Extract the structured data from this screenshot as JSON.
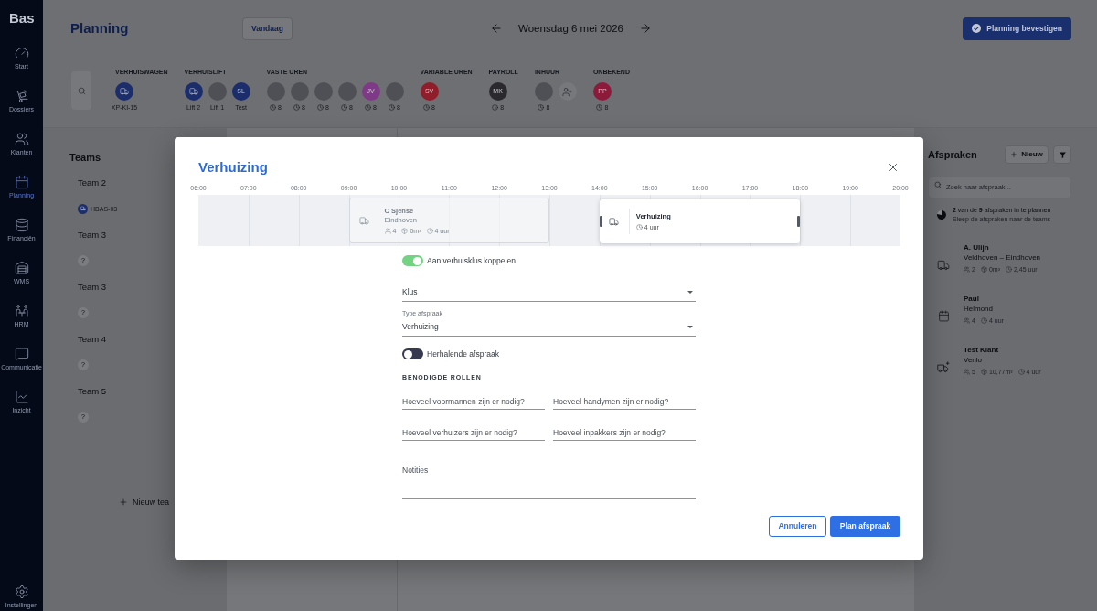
{
  "sidebar": {
    "logo": "Bas",
    "items": [
      {
        "label": "Start",
        "selected": false
      },
      {
        "label": "Dossiers",
        "selected": false
      },
      {
        "label": "Klanten",
        "selected": false
      },
      {
        "label": "Planning",
        "selected": true
      },
      {
        "label": "Financiën",
        "selected": false
      },
      {
        "label": "WMS",
        "selected": false
      },
      {
        "label": "HRM",
        "selected": false
      },
      {
        "label": "Communicatie",
        "selected": false
      },
      {
        "label": "Inzicht",
        "selected": false
      }
    ],
    "settings": "Instellingen"
  },
  "header": {
    "title": "Planning",
    "today": "Vandaag",
    "date": "Woensdag 6 mei 2026",
    "confirm": "Planning bevestigen"
  },
  "resources": [
    {
      "title": "VERHUISWAGEN",
      "add_button": false,
      "items": [
        {
          "kind": "icon",
          "label": "XP-KI-15"
        }
      ]
    },
    {
      "title": "VERHUISLIFT",
      "add_button": false,
      "items": [
        {
          "kind": "icon",
          "label": "Lift 2"
        },
        {
          "kind": "photo",
          "label": "Lift 1"
        },
        {
          "kind": "initials",
          "initials": "SL",
          "color": "#1b2d6b",
          "label": "Test"
        }
      ]
    },
    {
      "title": "VASTE UREN",
      "add_button": false,
      "items": [
        {
          "kind": "photo",
          "hours": "8"
        },
        {
          "kind": "photo",
          "hours": "8"
        },
        {
          "kind": "photo",
          "hours": "8"
        },
        {
          "kind": "photo",
          "hours": "8"
        },
        {
          "kind": "initials",
          "initials": "JV",
          "color": "#7e3a86",
          "hours": "8"
        },
        {
          "kind": "photo",
          "hours": "8"
        }
      ]
    },
    {
      "title": "VARIABLE UREN",
      "add_button": false,
      "items": [
        {
          "kind": "initials",
          "initials": "SV",
          "color": "#8f1d2a",
          "hours": "8"
        }
      ]
    },
    {
      "title": "PAYROLL",
      "add_button": false,
      "items": [
        {
          "kind": "initials",
          "initials": "MK",
          "color": "#2a2a2e",
          "hours": "8"
        }
      ]
    },
    {
      "title": "INHUUR",
      "add_button": true,
      "items": [
        {
          "kind": "photo",
          "hours": "8"
        }
      ]
    },
    {
      "title": "ONBEKEND",
      "add_button": false,
      "items": [
        {
          "kind": "initials",
          "initials": "PP",
          "color": "#8c1a3a",
          "hours": "8"
        }
      ]
    }
  ],
  "teams": {
    "title": "Teams",
    "items": [
      {
        "name": "Team 2",
        "chip": {
          "kind": "vehicle",
          "label": "HBAS-03"
        }
      },
      {
        "name": "Team 3",
        "chip": {
          "kind": "empty",
          "label": "?"
        }
      },
      {
        "name": "Team 3",
        "chip": {
          "kind": "empty",
          "label": "?"
        }
      },
      {
        "name": "Team 4",
        "chip": {
          "kind": "empty",
          "label": "?"
        }
      },
      {
        "name": "Team 5",
        "chip": {
          "kind": "empty",
          "label": "?"
        }
      }
    ],
    "new_button": "Nieuw tea"
  },
  "appointments": {
    "title": "Afspraken",
    "new_button": "Nieuw",
    "search": {
      "placeholder": "Zoek naar afspraak..."
    },
    "progress": {
      "text": "**2** van de **9** afspraken in te plannen",
      "hint": "Sleep de afspraken naar de teams",
      "level": 0.78
    },
    "items": [
      {
        "kind": "move",
        "name": "A. Ulijn",
        "place": "Veldhoven – Eindhoven",
        "stats": [
          {
            "kind": "people",
            "text": "2"
          },
          {
            "kind": "volume",
            "text": "0m³"
          },
          {
            "kind": "duration",
            "text": "2,45 uur"
          }
        ]
      },
      {
        "kind": "appointment",
        "name": "Paul",
        "place": "Helmond",
        "stats": [
          {
            "kind": "people",
            "text": "4"
          },
          {
            "kind": "duration",
            "text": "4 uur"
          }
        ]
      },
      {
        "kind": "move_lift",
        "name": "Test Klant",
        "place": "Venlo",
        "stats": [
          {
            "kind": "people",
            "text": "5"
          },
          {
            "kind": "volume",
            "text": "10,77m³"
          },
          {
            "kind": "duration",
            "text": "4 uur"
          }
        ]
      }
    ]
  },
  "modal": {
    "title": "Verhuizing",
    "timeline": {
      "hours": [
        "06:00",
        "07:00",
        "08:00",
        "09:00",
        "10:00",
        "11:00",
        "12:00",
        "13:00",
        "14:00",
        "15:00",
        "16:00",
        "17:00",
        "18:00",
        "19:00",
        "20:00"
      ],
      "blocks": [
        {
          "selected": false,
          "title": "C Sjense",
          "subtitle": "Eindhoven",
          "stats": [
            {
              "kind": "people",
              "text": "4"
            },
            {
              "kind": "volume",
              "text": "0m³"
            },
            {
              "kind": "duration",
              "text": "4 uur"
            }
          ]
        },
        {
          "selected": true,
          "title": "Verhuizing",
          "stats": [
            {
              "kind": "duration",
              "text": "4 uur"
            }
          ]
        }
      ]
    },
    "link_toggle": {
      "label": "Aan verhuisklus koppelen",
      "on": true
    },
    "job_select": {
      "label": "Klus"
    },
    "type_select": {
      "label": "Type afspraak",
      "value": "Verhuizing"
    },
    "repeat_toggle": {
      "label": "Herhalende afspraak",
      "on": false
    },
    "roles": {
      "title": "BENODIGDE ROLLEN",
      "fields": [
        {
          "placeholder": "Hoeveel voormannen zijn er nodig?"
        },
        {
          "placeholder": "Hoeveel handymen zijn er nodig?"
        },
        {
          "placeholder": "Hoeveel verhuizers zijn er nodig?"
        },
        {
          "placeholder": "Hoeveel inpakkers zijn er nodig?"
        }
      ]
    },
    "notes": {
      "placeholder": "Notities"
    },
    "buttons": {
      "cancel": "Annuleren",
      "submit": "Plan afspraak"
    }
  }
}
